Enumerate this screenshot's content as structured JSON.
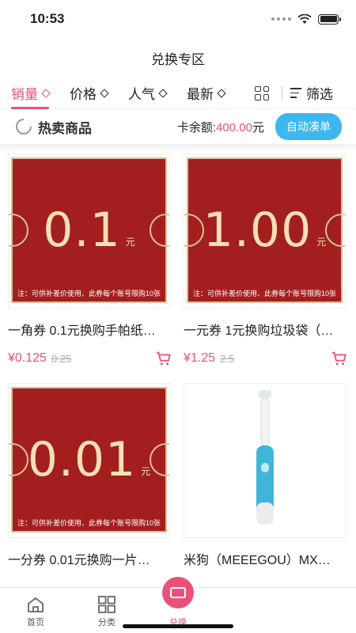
{
  "status": {
    "time": "10:53"
  },
  "header": {
    "title": "兑换专区"
  },
  "sort_bar": {
    "items": [
      {
        "label": "销量",
        "active": true
      },
      {
        "label": "价格",
        "active": false
      },
      {
        "label": "人气",
        "active": false
      },
      {
        "label": "最新",
        "active": false
      }
    ],
    "filter_label": "筛选"
  },
  "hot": {
    "title": "热卖商品",
    "balance_label": "卡余额:",
    "balance_value": "400.00",
    "balance_unit": "元",
    "auto_button": "自动凑单"
  },
  "products": [
    {
      "coupon_value": "0.1",
      "coupon_unit": "元",
      "coupon_note": "注：可供补差价使用、此券每个账号限购10张",
      "title": "一角券 0.1元换购手帕纸…",
      "price": "¥0.125",
      "old_price": "0.25"
    },
    {
      "coupon_value": "1.00",
      "coupon_unit": "元",
      "coupon_note": "注：可供补差价使用、此券每个账号限购10张",
      "title": "一元券 1元换购垃圾袋（…",
      "price": "¥1.25",
      "old_price": "2.5"
    },
    {
      "coupon_value": "0.01",
      "coupon_unit": "元",
      "coupon_note": "注：可供补差价使用、此券每个账号限购10张",
      "title": "一分券 0.01元换购一片…"
    },
    {
      "title": "米狗（MEEEGOU）MX…"
    }
  ],
  "tabbar": {
    "items": [
      {
        "label": "首页"
      },
      {
        "label": "分类"
      },
      {
        "label": "兑换"
      }
    ]
  },
  "colors": {
    "accent": "#e8527a",
    "button_blue": "#3eb7ee",
    "coupon_red": "#a31f1f",
    "coupon_gold": "#f6dfb5"
  }
}
